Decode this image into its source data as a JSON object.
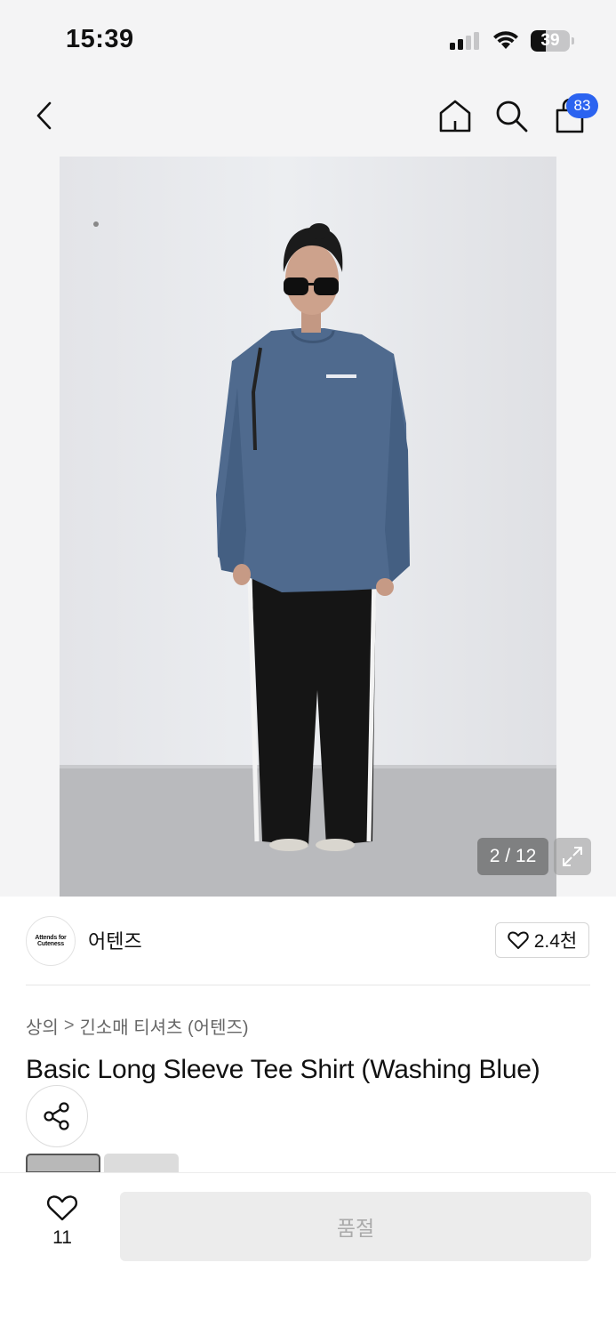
{
  "status_bar": {
    "time": "15:39",
    "battery_level": "39",
    "icons": [
      "cellular-signal-icon",
      "wifi-icon",
      "battery-icon"
    ]
  },
  "nav": {
    "icons": [
      "back-chevron-icon",
      "home-icon",
      "search-icon",
      "shopping-bag-icon"
    ],
    "cart_count": "83"
  },
  "gallery": {
    "counter": "2 / 12",
    "current_index": 2,
    "total": 12,
    "expand_icon": "expand-arrows-icon"
  },
  "brand": {
    "logo_text": [
      "Attends for",
      "Cuteness"
    ],
    "name": "어텐즈",
    "like_count": "2.4천",
    "like_icon": "heart-outline-icon"
  },
  "breadcrumb": {
    "items": [
      "상의",
      "긴소매 티셔츠 (어텐즈)"
    ],
    "separator": ">"
  },
  "product": {
    "title": "Basic Long Sleeve Tee Shirt (Washing Blue)",
    "share_icon": "share-icon"
  },
  "bottom_bar": {
    "wish_count": "11",
    "wish_icon": "heart-outline-icon",
    "action_label": "품절"
  },
  "colors": {
    "accent_badge": "#2b63f0",
    "header_bg": "#f4f4f5",
    "disabled_button_bg": "#ececec",
    "disabled_button_text": "#aaaaaa",
    "shirt": "#4f6a8e"
  }
}
